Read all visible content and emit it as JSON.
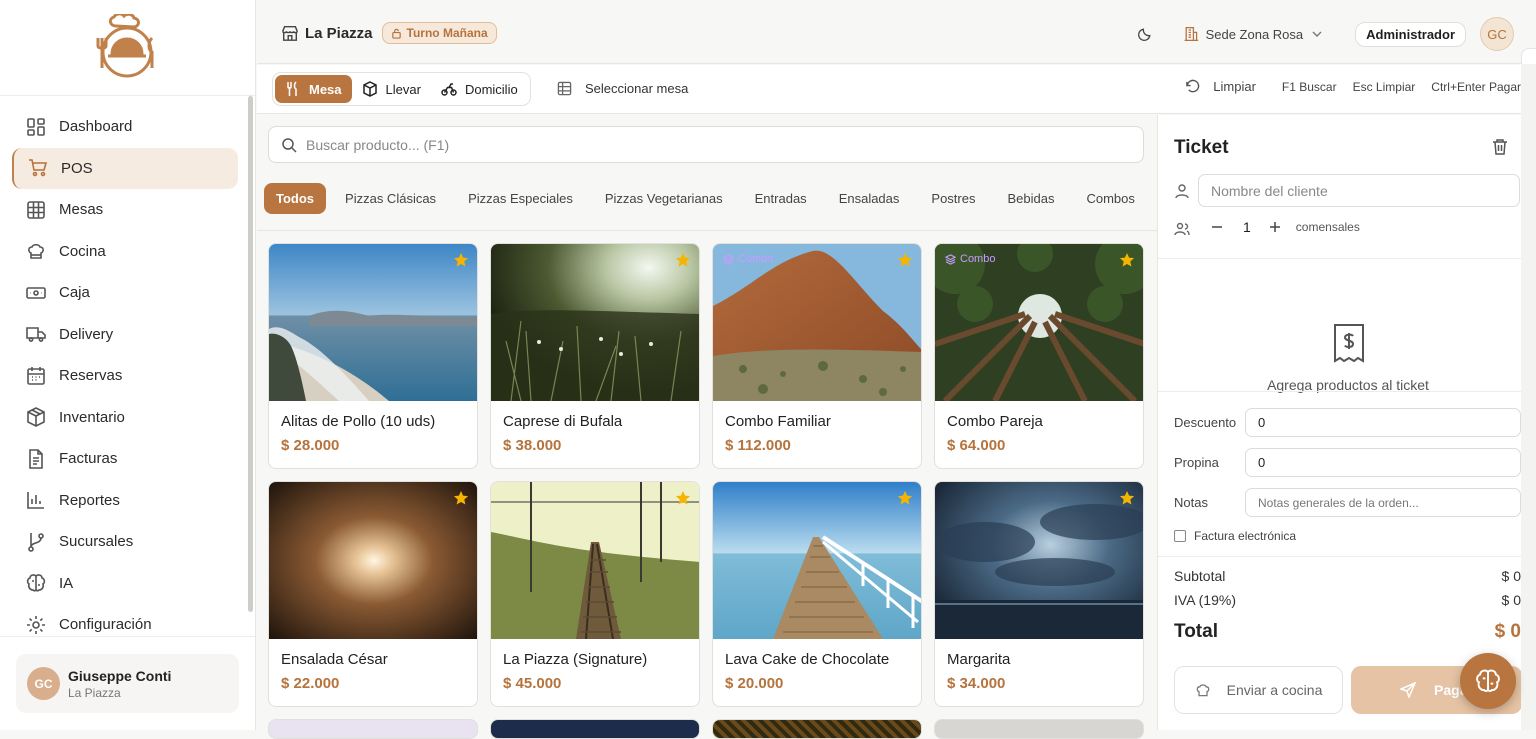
{
  "sidebar": {
    "nav": [
      {
        "label": "Dashboard",
        "icon": "dashboard-icon"
      },
      {
        "label": "POS",
        "icon": "cart-icon",
        "active": true
      },
      {
        "label": "Mesas",
        "icon": "grid-icon"
      },
      {
        "label": "Cocina",
        "icon": "chef-hat-icon"
      },
      {
        "label": "Caja",
        "icon": "cash-icon"
      },
      {
        "label": "Delivery",
        "icon": "truck-icon"
      },
      {
        "label": "Reservas",
        "icon": "calendar-icon"
      },
      {
        "label": "Inventario",
        "icon": "box-icon"
      },
      {
        "label": "Facturas",
        "icon": "document-icon"
      },
      {
        "label": "Reportes",
        "icon": "bar-chart-icon"
      },
      {
        "label": "Sucursales",
        "icon": "branch-icon"
      },
      {
        "label": "IA",
        "icon": "brain-icon"
      },
      {
        "label": "Configuración",
        "icon": "gear-icon"
      }
    ],
    "user": {
      "initials": "GC",
      "name": "Giuseppe Conti",
      "store": "La Piazza"
    }
  },
  "topbar": {
    "store": "La Piazza",
    "shift": "Turno Mañana",
    "site": "Sede Zona Rosa",
    "role": "Administrador",
    "initials": "GC"
  },
  "orderbar": {
    "types": [
      {
        "label": "Mesa",
        "icon": "utensils-icon",
        "active": true
      },
      {
        "label": "Llevar",
        "icon": "package-icon"
      },
      {
        "label": "Domicilio",
        "icon": "bike-icon"
      }
    ],
    "select_table": "Seleccionar mesa",
    "clear": "Limpiar",
    "shortcuts": [
      "F1 Buscar",
      "Esc Limpiar",
      "Ctrl+Enter Pagar"
    ]
  },
  "search": {
    "placeholder": "Buscar producto... (F1)"
  },
  "categories": [
    "Todos",
    "Pizzas Clásicas",
    "Pizzas Especiales",
    "Pizzas Vegetarianas",
    "Entradas",
    "Ensaladas",
    "Postres",
    "Bebidas",
    "Combos"
  ],
  "products": [
    {
      "name": "Alitas de Pollo (10 uds)",
      "price": "$ 28.000",
      "combo": false,
      "scene": "coast"
    },
    {
      "name": "Caprese di Bufala",
      "price": "$ 38.000",
      "combo": false,
      "scene": "grass"
    },
    {
      "name": "Combo Familiar",
      "price": "$ 112.000",
      "combo": true,
      "badge": "Combo",
      "scene": "rock"
    },
    {
      "name": "Combo Pareja",
      "price": "$ 64.000",
      "combo": true,
      "badge": "Combo",
      "scene": "forest"
    },
    {
      "name": "Ensalada César",
      "price": "$ 22.000",
      "combo": false,
      "scene": "tunnel"
    },
    {
      "name": "La Piazza (Signature)",
      "price": "$ 45.000",
      "combo": false,
      "scene": "rails"
    },
    {
      "name": "Lava Cake de Chocolate",
      "price": "$ 20.000",
      "combo": false,
      "scene": "pier"
    },
    {
      "name": "Margarita",
      "price": "$ 34.000",
      "combo": false,
      "scene": "storm"
    }
  ],
  "ticket": {
    "title": "Ticket",
    "customer_placeholder": "Nombre del cliente",
    "diners": "1",
    "diners_label": "comensales",
    "empty": "Agrega productos al ticket",
    "discount_label": "Descuento",
    "discount": "0",
    "tip_label": "Propina",
    "tip": "0",
    "notes_label": "Notas",
    "notes_placeholder": "Notas generales de la orden...",
    "invoice_label": "Factura electrónica",
    "subtotal_label": "Subtotal",
    "subtotal": "$ 0",
    "tax_label": "IVA (19%)",
    "tax": "$ 0",
    "total_label": "Total",
    "total": "$ 0",
    "send_kitchen": "Enviar a cocina",
    "pay": "Pagar"
  },
  "colors": {
    "accent": "#b8753f",
    "accent_light": "#f6ebe0",
    "star": "#f4b400"
  }
}
